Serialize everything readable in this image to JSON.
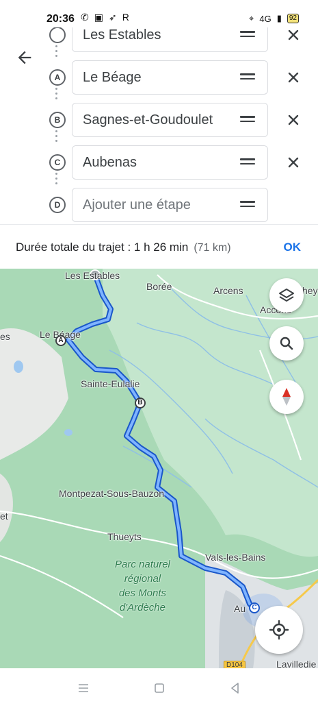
{
  "status_bar": {
    "time": "20:36",
    "network": "4G",
    "battery": "92"
  },
  "planner": {
    "stops": [
      {
        "marker": "",
        "name": "Les Estables",
        "placeholder": false
      },
      {
        "marker": "A",
        "name": "Le Béage",
        "placeholder": false
      },
      {
        "marker": "B",
        "name": "Sagnes-et-Goudoulet",
        "placeholder": false
      },
      {
        "marker": "C",
        "name": "Aubenas",
        "placeholder": false
      },
      {
        "marker": "D",
        "name": "Ajouter une étape",
        "placeholder": true
      }
    ]
  },
  "summary": {
    "duration_label": "Durée totale du trajet : 1 h 26 min",
    "distance": "(71 km)",
    "ok_label": "OK"
  },
  "map": {
    "route_color": "#4285f4",
    "places": {
      "les_estables": "Les Estables",
      "boree": "Borée",
      "arcens": "Arcens",
      "accons": "Accons",
      "le_beage": "Le Béage",
      "sainte_eulalie": "Sainte-Eulalie",
      "montpezat": "Montpezat-Sous-Bauzon",
      "thueyts": "Thueyts",
      "vals": "Vals-les-Bains",
      "aubenas_partial": "Au",
      "lavilledieu": "Lavilledie",
      "es_partial": "es",
      "et_partial": "et",
      "hey_partial": "hey"
    },
    "park_name": "Parc naturel\nrégional\ndes Monts\nd'Ardèche",
    "road_badge": "D104",
    "markers": {
      "a": "A",
      "b": "B",
      "c": "C"
    }
  },
  "icons": {
    "back": "arrow-left-icon",
    "layers": "layers-icon",
    "search": "search-icon",
    "compass": "compass-icon",
    "locate": "my-location-icon"
  }
}
